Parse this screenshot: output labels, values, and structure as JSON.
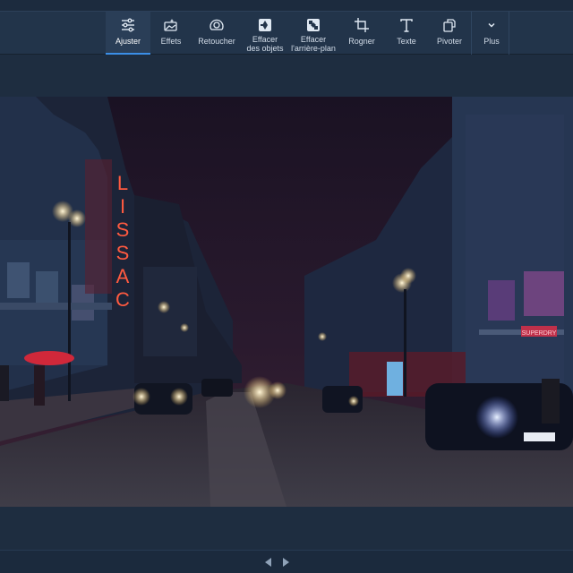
{
  "toolbar": {
    "tools": [
      {
        "id": "adjust",
        "icon": "sliders-icon",
        "label": "Ajuster",
        "active": true
      },
      {
        "id": "effects",
        "icon": "magic-photo-icon",
        "label": "Effets",
        "active": false
      },
      {
        "id": "retouch",
        "icon": "face-retouch-icon",
        "label": "Retoucher",
        "active": false
      },
      {
        "id": "erase-objects",
        "icon": "erase-objects-icon",
        "label_line1": "Effacer",
        "label_line2": "des objets",
        "active": false
      },
      {
        "id": "erase-background",
        "icon": "erase-background-icon",
        "label_line1": "Effacer",
        "label_line2": "l'arrière-plan",
        "active": false
      },
      {
        "id": "crop",
        "icon": "crop-icon",
        "label": "Rogner",
        "active": false
      },
      {
        "id": "text",
        "icon": "text-icon",
        "label": "Texte",
        "active": false
      },
      {
        "id": "rotate",
        "icon": "rotate-icon",
        "label": "Pivoter",
        "active": false
      },
      {
        "id": "more",
        "icon": "chevron-down-icon",
        "label": "Plus",
        "active": false
      }
    ]
  },
  "photo": {
    "sign_text": "LISSAC",
    "shop_sign": "SUPERDRY",
    "description_icon": "night-street-photo"
  },
  "footer": {
    "prev_icon": "triangle-left-icon",
    "next_icon": "triangle-right-icon"
  },
  "colors": {
    "accent": "#3b8ee6",
    "toolbar_bg": "#22344a",
    "app_bg": "#1b2a3d"
  }
}
